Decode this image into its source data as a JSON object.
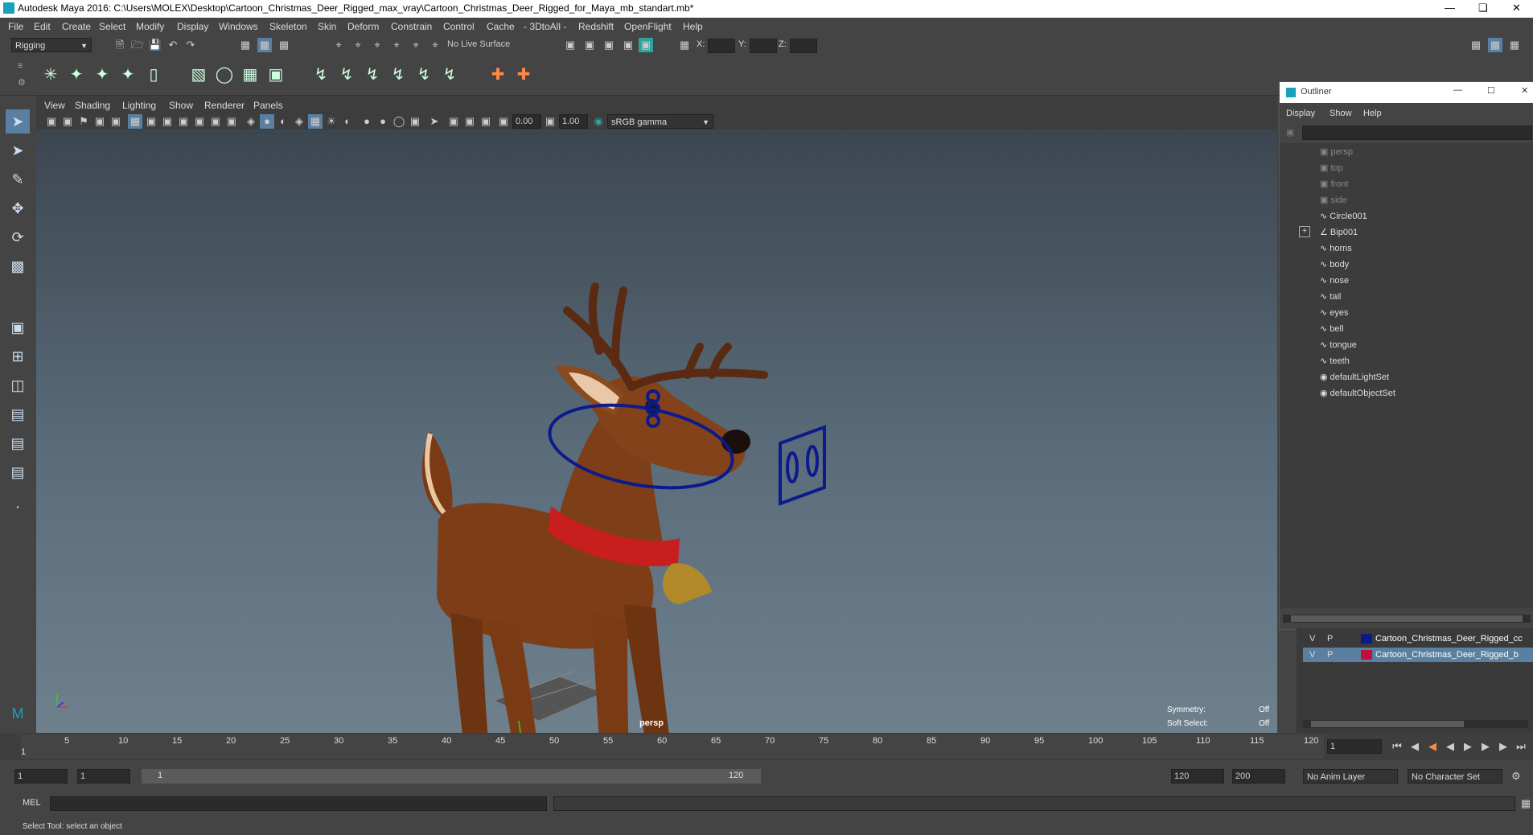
{
  "window": {
    "title": "Autodesk Maya 2016: C:\\Users\\MOLEX\\Desktop\\Cartoon_Christmas_Deer_Rigged_max_vray\\Cartoon_Christmas_Deer_Rigged_for_Maya_mb_standart.mb*"
  },
  "menu": [
    "File",
    "Edit",
    "Create",
    "Select",
    "Modify",
    "Display",
    "Windows",
    "Skeleton",
    "Skin",
    "Deform",
    "Constrain",
    "Control",
    "Cache",
    "- 3DtoAll -",
    "Redshift",
    "OpenFlight",
    "Help"
  ],
  "status_line": {
    "menu_set": "Rigging",
    "live_surface": "No Live Surface",
    "x_label": "X:",
    "y_label": "Y:",
    "z_label": "Z:"
  },
  "viewport": {
    "menu": [
      "View",
      "Shading",
      "Lighting",
      "Show",
      "Renderer",
      "Panels"
    ],
    "exposure": "0.00",
    "gamma": "1.00",
    "color_space": "sRGB gamma",
    "camera_label": "persp",
    "symmetry_label": "Symmetry:",
    "symmetry_value": "Off",
    "soft_select_label": "Soft Select:",
    "soft_select_value": "Off"
  },
  "outliner": {
    "title": "Outliner",
    "menu": [
      "Display",
      "Show",
      "Help"
    ],
    "items": [
      {
        "label": "persp",
        "kind": "camera"
      },
      {
        "label": "top",
        "kind": "camera"
      },
      {
        "label": "front",
        "kind": "camera"
      },
      {
        "label": "side",
        "kind": "camera"
      },
      {
        "label": "Circle001",
        "kind": "curve"
      },
      {
        "label": "Bip001",
        "kind": "joint"
      },
      {
        "label": "horns",
        "kind": "mesh"
      },
      {
        "label": "body",
        "kind": "mesh"
      },
      {
        "label": "nose",
        "kind": "mesh"
      },
      {
        "label": "tail",
        "kind": "mesh"
      },
      {
        "label": "eyes",
        "kind": "mesh"
      },
      {
        "label": "bell",
        "kind": "mesh"
      },
      {
        "label": "tongue",
        "kind": "mesh"
      },
      {
        "label": "teeth",
        "kind": "mesh"
      },
      {
        "label": "defaultLightSet",
        "kind": "set"
      },
      {
        "label": "defaultObjectSet",
        "kind": "set"
      }
    ]
  },
  "layers": [
    {
      "v": "V",
      "p": "P",
      "name": "Cartoon_Christmas_Deer_Rigged_cc",
      "color": "#0a1a8a"
    },
    {
      "v": "V",
      "p": "P",
      "name": "Cartoon_Christmas_Deer_Rigged_b",
      "color": "#c0103a"
    }
  ],
  "timeline": {
    "ticks": [
      "1",
      "5",
      "10",
      "15",
      "20",
      "25",
      "30",
      "35",
      "40",
      "45",
      "50",
      "55",
      "60",
      "65",
      "70",
      "75",
      "80",
      "85",
      "90",
      "95",
      "100",
      "105",
      "110",
      "115",
      "120"
    ],
    "current_frame": "1"
  },
  "range": {
    "start": "1",
    "start_inner": "1",
    "slider_start": "1",
    "slider_end": "120",
    "end_inner": "120",
    "end": "200",
    "anim_layer": "No Anim Layer",
    "character_set": "No Character Set"
  },
  "command_line": {
    "label": "MEL"
  },
  "help_line": "Select Tool: select an object",
  "colors": {
    "ui_bg": "#444444",
    "deer_body": "#7a3b14",
    "collar": "#c81e1e",
    "rig_controls": "#0b1a8c"
  }
}
